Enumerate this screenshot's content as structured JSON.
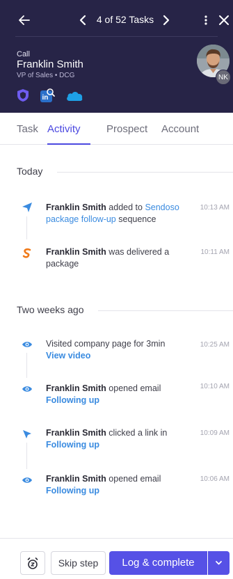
{
  "header": {
    "task_counter": "4 of 52 Tasks",
    "task_type": "Call",
    "contact_name": "Franklin Smith",
    "contact_title": "VP of Sales • DCG",
    "avatar_initials": "NK",
    "colors": {
      "background": "#272447",
      "shield": "#6e5cf0",
      "linkedin": "#2a6fc9",
      "cloud": "#1ea0e6"
    },
    "icons": [
      "back-arrow-icon",
      "chevron-left-icon",
      "chevron-right-icon",
      "more-vertical-icon",
      "close-icon",
      "shield-icon",
      "linkedin-search-icon",
      "salesforce-cloud-icon"
    ]
  },
  "tabs": [
    "Task",
    "Activity",
    "Prospect",
    "Account"
  ],
  "active_tab": "Activity",
  "sections": [
    {
      "label": "Today",
      "events": [
        {
          "icon": "send-icon",
          "who": "Franklin Smith",
          "text": " added to ",
          "link": "Sendoso package follow-up",
          "suffix": " sequence",
          "time": "10:13 AM"
        },
        {
          "icon": "sendoso-icon",
          "who": "Franklin Smith",
          "text": " was delivered a package",
          "link": "",
          "suffix": "",
          "time": "10:11 AM"
        }
      ]
    },
    {
      "label": "Two weeks ago",
      "events": [
        {
          "icon": "eye-icon",
          "who": "",
          "text": "Visited company page for 3min",
          "link": "View video",
          "suffix": "",
          "time": "10:25 AM"
        },
        {
          "icon": "eye-icon",
          "who": "Franklin Smith",
          "text": " opened email",
          "link": "Following up",
          "suffix": "",
          "time": "10:10 AM"
        },
        {
          "icon": "cursor-icon",
          "who": "Franklin Smith",
          "text": " clicked a link in",
          "link": "Following up",
          "suffix": "",
          "time": "10:09 AM"
        },
        {
          "icon": "eye-icon",
          "who": "Franklin Smith",
          "text": " opened email",
          "link": "Following up",
          "suffix": "",
          "time": "10:06 AM"
        }
      ]
    }
  ],
  "footer": {
    "skip_label": "Skip step",
    "log_label": "Log & complete",
    "accent": "#5651e6"
  }
}
